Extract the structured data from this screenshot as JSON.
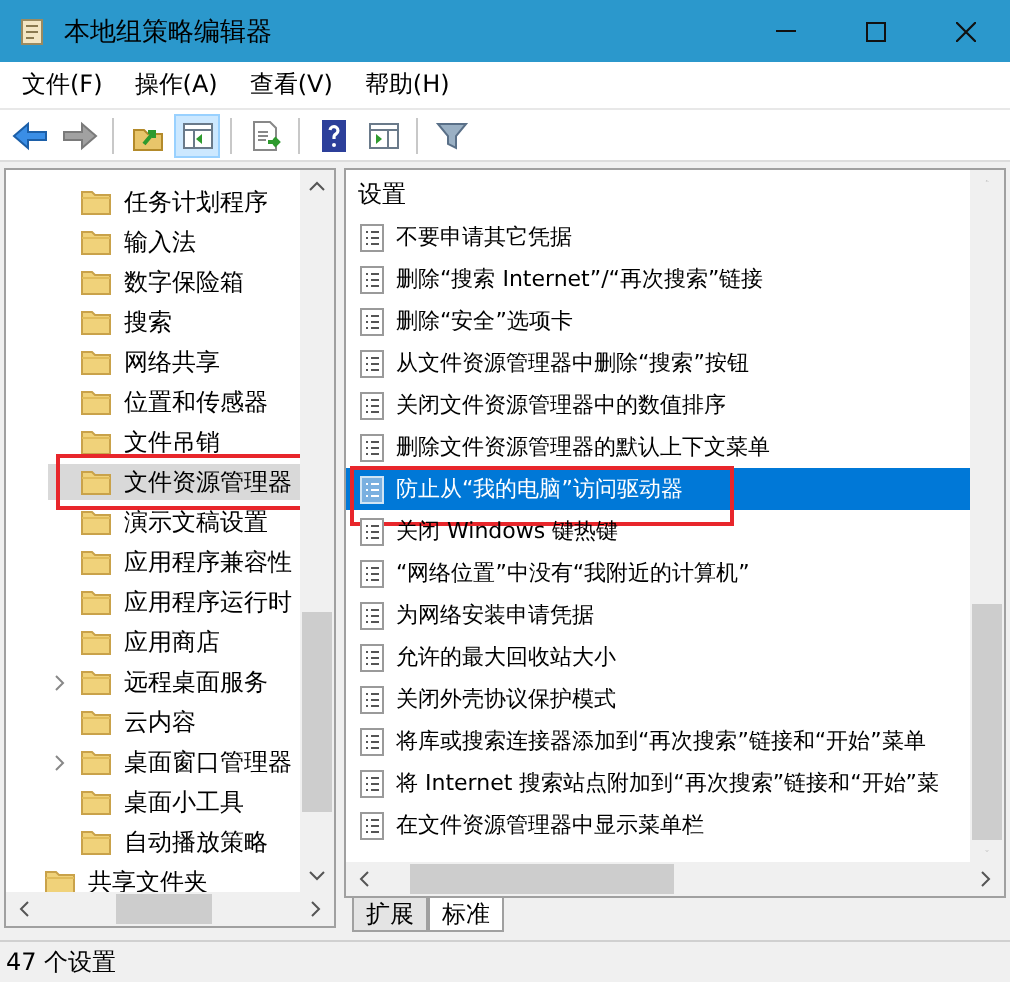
{
  "window": {
    "title": "本地组策略编辑器"
  },
  "menu": [
    "文件(F)",
    "操作(A)",
    "查看(V)",
    "帮助(H)"
  ],
  "toolbar": [
    {
      "kind": "back",
      "disabled": false,
      "pressed": false
    },
    {
      "kind": "forward",
      "disabled": true,
      "pressed": false
    },
    {
      "kind": "separator"
    },
    {
      "kind": "up",
      "disabled": false,
      "pressed": false
    },
    {
      "kind": "tree",
      "disabled": false,
      "pressed": true
    },
    {
      "kind": "separator"
    },
    {
      "kind": "export",
      "disabled": false,
      "pressed": false
    },
    {
      "kind": "separator"
    },
    {
      "kind": "help",
      "disabled": false,
      "pressed": false
    },
    {
      "kind": "actions",
      "disabled": false,
      "pressed": false
    },
    {
      "kind": "separator"
    },
    {
      "kind": "filter",
      "disabled": false,
      "pressed": false
    }
  ],
  "tree": [
    {
      "children": [
        {
          "label": "任务计划程序",
          "expandable": false,
          "selected": false,
          "annotated": false
        },
        {
          "label": "输入法",
          "expandable": false,
          "selected": false,
          "annotated": false
        },
        {
          "label": "数字保险箱",
          "expandable": false,
          "selected": false,
          "annotated": false
        },
        {
          "label": "搜索",
          "expandable": false,
          "selected": false,
          "annotated": false
        },
        {
          "label": "网络共享",
          "expandable": false,
          "selected": false,
          "annotated": false
        },
        {
          "label": "位置和传感器",
          "expandable": false,
          "selected": false,
          "annotated": false
        },
        {
          "label": "文件吊销",
          "expandable": false,
          "selected": false,
          "annotated": false
        },
        {
          "label": "文件资源管理器",
          "expandable": false,
          "selected": true,
          "annotated": true
        },
        {
          "label": "演示文稿设置",
          "expandable": false,
          "selected": false,
          "annotated": false
        },
        {
          "label": "应用程序兼容性",
          "expandable": false,
          "selected": false,
          "annotated": false
        },
        {
          "label": "应用程序运行时",
          "expandable": false,
          "selected": false,
          "annotated": false
        },
        {
          "label": "应用商店",
          "expandable": false,
          "selected": false,
          "annotated": false
        },
        {
          "label": "远程桌面服务",
          "expandable": true,
          "selected": false,
          "annotated": false
        },
        {
          "label": "云内容",
          "expandable": false,
          "selected": false,
          "annotated": false
        },
        {
          "label": "桌面窗口管理器",
          "expandable": true,
          "selected": false,
          "annotated": false
        },
        {
          "label": "桌面小工具",
          "expandable": false,
          "selected": false,
          "annotated": false
        },
        {
          "label": "自动播放策略",
          "expandable": false,
          "selected": false,
          "annotated": false
        }
      ]
    },
    {
      "label": "共享文件夹",
      "expandable": false,
      "selected": false,
      "annotated": false
    }
  ],
  "settings": {
    "column": "设置",
    "items": [
      {
        "label": "不要申请其它凭据",
        "selected": false,
        "annotated": false
      },
      {
        "label": "删除“搜索 Internet”/“再次搜索”链接",
        "selected": false,
        "annotated": false
      },
      {
        "label": "删除“安全”选项卡",
        "selected": false,
        "annotated": false
      },
      {
        "label": "从文件资源管理器中删除“搜索”按钮",
        "selected": false,
        "annotated": false
      },
      {
        "label": "关闭文件资源管理器中的数值排序",
        "selected": false,
        "annotated": false
      },
      {
        "label": "删除文件资源管理器的默认上下文菜单",
        "selected": false,
        "annotated": false
      },
      {
        "label": "防止从“我的电脑”访问驱动器",
        "selected": true,
        "annotated": true
      },
      {
        "label": "关闭 Windows 键热键",
        "selected": false,
        "annotated": false
      },
      {
        "label": "“网络位置”中没有“我附近的计算机”",
        "selected": false,
        "annotated": false
      },
      {
        "label": "为网络安装申请凭据",
        "selected": false,
        "annotated": false
      },
      {
        "label": "允许的最大回收站大小",
        "selected": false,
        "annotated": false
      },
      {
        "label": "关闭外壳协议保护模式",
        "selected": false,
        "annotated": false
      },
      {
        "label": "将库或搜索连接器添加到“再次搜索”链接和“开始”菜单",
        "selected": false,
        "annotated": false
      },
      {
        "label": "将 Internet 搜索站点附加到“再次搜索”链接和“开始”菜",
        "selected": false,
        "annotated": false
      },
      {
        "label": "在文件资源管理器中显示菜单栏",
        "selected": false,
        "annotated": false
      }
    ]
  },
  "tabs": [
    {
      "label": "扩展",
      "selected": false
    },
    {
      "label": "标准",
      "selected": true
    }
  ],
  "status_bar": "47 个设置"
}
